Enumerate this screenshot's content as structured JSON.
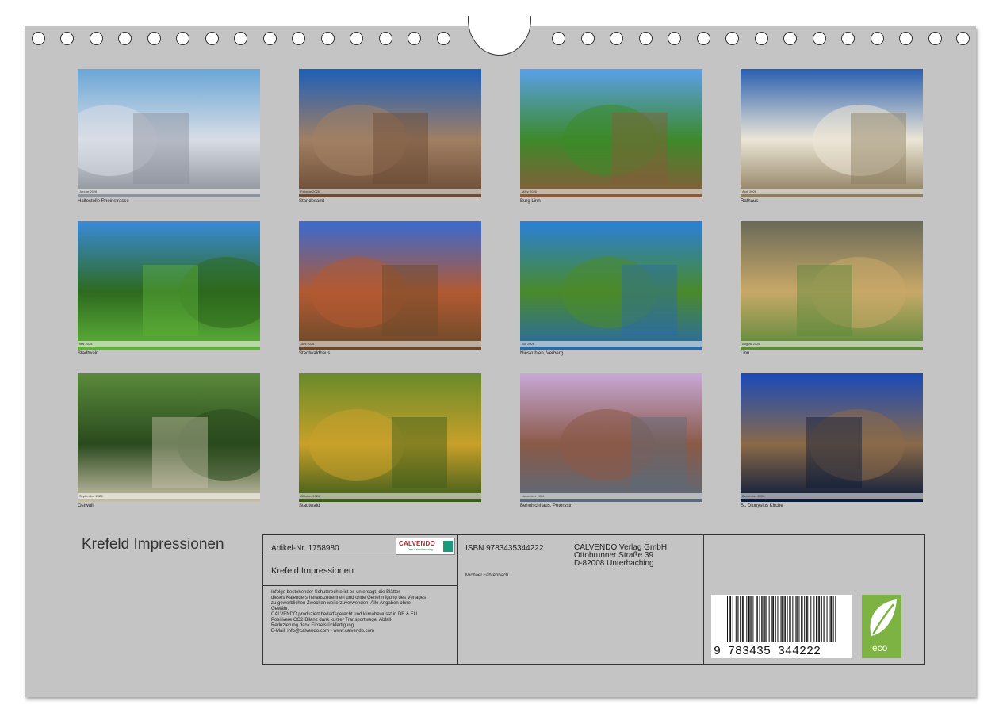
{
  "months": [
    {
      "photo": "Haltestelle Rheinstrasse",
      "month_label": "Januar 2026",
      "palette": [
        "#6aa6d6",
        "#d8dde6",
        "#8a8f98"
      ]
    },
    {
      "photo": "Standesamt",
      "month_label": "Februar 2026",
      "palette": [
        "#1e5fb8",
        "#a07f63",
        "#6a4a34"
      ]
    },
    {
      "photo": "Burg Linn",
      "month_label": "März 2026",
      "palette": [
        "#5aa0e8",
        "#3d8a2a",
        "#8a5a3a"
      ]
    },
    {
      "photo": "Rathaus",
      "month_label": "April 2026",
      "palette": [
        "#2a5fb0",
        "#ece6d6",
        "#8a7a5a"
      ]
    },
    {
      "photo": "Stadtwald",
      "month_label": "Mai 2026",
      "palette": [
        "#3a8ad8",
        "#2d6a1e",
        "#5fb23a"
      ]
    },
    {
      "photo": "Stadtwaldhaus",
      "month_label": "Juni 2026",
      "palette": [
        "#3a6ad0",
        "#b25a32",
        "#6a4a2a"
      ]
    },
    {
      "photo": "Nieskuhlen, Verberg",
      "month_label": "Juli 2026",
      "palette": [
        "#2a80d8",
        "#4a8a2a",
        "#2a6aa8"
      ]
    },
    {
      "photo": "Linn",
      "month_label": "August 2026",
      "palette": [
        "#6a6a58",
        "#c8a868",
        "#5a8a3a"
      ]
    },
    {
      "photo": "Ostwall",
      "month_label": "September 2026",
      "palette": [
        "#5a8a3a",
        "#2a4a1e",
        "#c8c0a8"
      ]
    },
    {
      "photo": "Stadtwald",
      "month_label": "Oktober 2026",
      "palette": [
        "#6a8a2a",
        "#c8a02a",
        "#3a5a1a"
      ]
    },
    {
      "photo": "Behnischhaus, Petersstr.",
      "month_label": "November 2026",
      "palette": [
        "#c8a8d8",
        "#8a5a48",
        "#5a6a7a"
      ]
    },
    {
      "photo": "St. Dionysius Kirche",
      "month_label": "Dezember 2026",
      "palette": [
        "#1a4ab8",
        "#8a6a48",
        "#0a1a3a"
      ]
    }
  ],
  "book": {
    "title": "Krefeld Impressionen"
  },
  "info": {
    "article": "Artikel-Nr. 1758980",
    "title": "Krefeld Impressionen",
    "legal": [
      "Infolge bestehender Schutzrechte ist es untersagt, die Blätter",
      "dieses Kalenders herauszutrennen und ohne Genehmigung des Verlages",
      "zu gewerblichen Zwecken weiterzuverwenden. Alle Angaben ohne",
      "Gewähr.",
      "CALVENDO produziert bedarfsgerecht und klimabewusst in DE & EU.",
      "Positivere CO2-Bilanz dank kurzer Transportwege. Abfall-",
      "Reduzierung dank Einzelstückfertigung.",
      "E-Mail: info@calvendo.com • www.calvendo.com"
    ],
    "isbn": "ISBN 9783435344222",
    "author": "Michael Fahrenbach",
    "publisher": [
      "CALVENDO Verlag GmbH",
      "Ottobrunner Straße 39",
      "D-82008 Unterhaching"
    ],
    "logo_brand": "CALVENDO",
    "logo_sub": "Dein Kalenderverlag",
    "barcode_number": "9 783435 344222",
    "eco_label": "eco"
  },
  "colors": {
    "page": "#c4c4c4",
    "rule": "#333333",
    "eco": "#7cb342",
    "calvendo_red": "#b0282f"
  }
}
